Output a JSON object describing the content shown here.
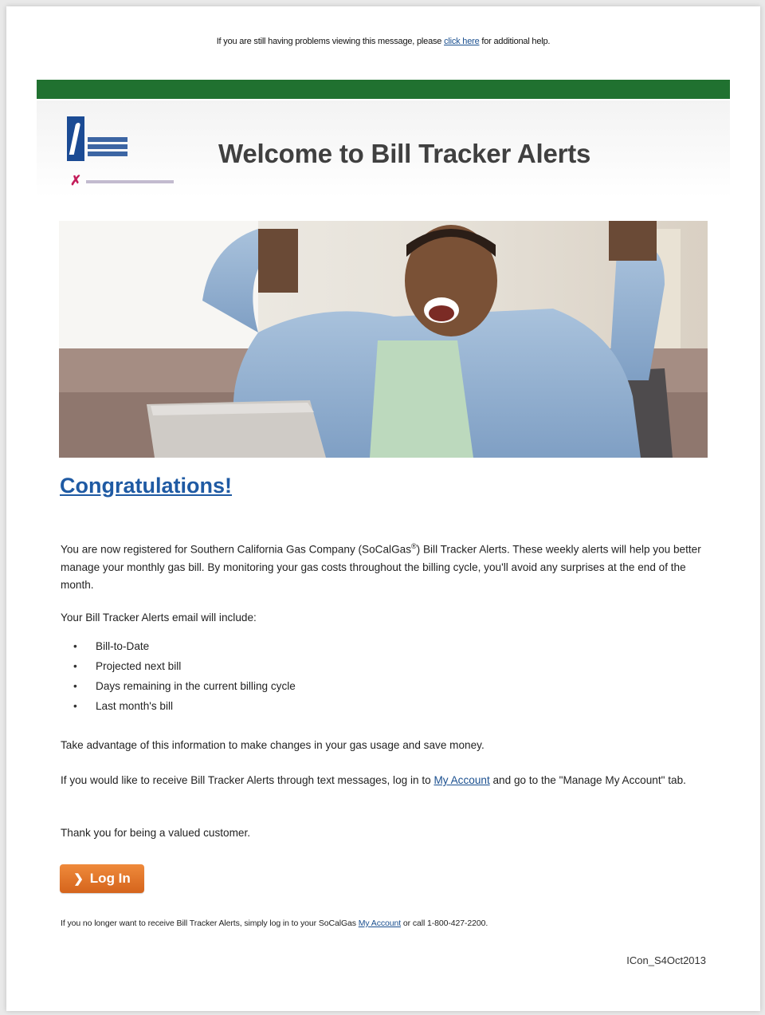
{
  "preheader": {
    "text_before": "If you are still having problems viewing this message, please ",
    "link": "click here",
    "text_after": " for additional help."
  },
  "header": {
    "title": "Welcome to Bill Tracker Alerts",
    "logo_icon": "socalgas-logo",
    "sub_logo_icon": "sempra-energy-logo",
    "accent_green": "#207130",
    "title_color": "#404040"
  },
  "hero": {
    "image_icon": "man-celebrating-with-laptop-photo"
  },
  "congrats": {
    "heading": "Congratulations!",
    "color": "#1f5aa3"
  },
  "body": {
    "p1_before": "You are now registered for Southern California Gas Company (SoCalGas",
    "p1_reg": "®",
    "p1_after": ") Bill Tracker Alerts. These weekly alerts will help you better manage your monthly gas bill. By monitoring your gas costs throughout the billing cycle, you'll avoid any surprises at the end of the month.",
    "p2": "Your Bill Tracker Alerts email will include:",
    "bullets": [
      "Bill-to-Date",
      "Projected next bill",
      "Days remaining in the current billing cycle",
      "Last month's bill"
    ],
    "p3": "Take advantage of this information to make changes in your gas usage and save money.",
    "p4_before": "If you would like to receive Bill Tracker Alerts through text messages, log in to ",
    "p4_link": "My Account",
    "p4_after": " and go to the \"Manage My Account\" tab.",
    "p5": "Thank you for being a valued customer."
  },
  "login_button": {
    "label": "Log In",
    "icon": "chevron-right-icon",
    "color": "#e2772a"
  },
  "footer": {
    "text_before": "If you no longer want to receive Bill Tracker Alerts, simply log in to your SoCalGas ",
    "link": "My Account",
    "text_after": " or call 1-800-427-2200.",
    "code": "ICon_S4Oct2013"
  }
}
